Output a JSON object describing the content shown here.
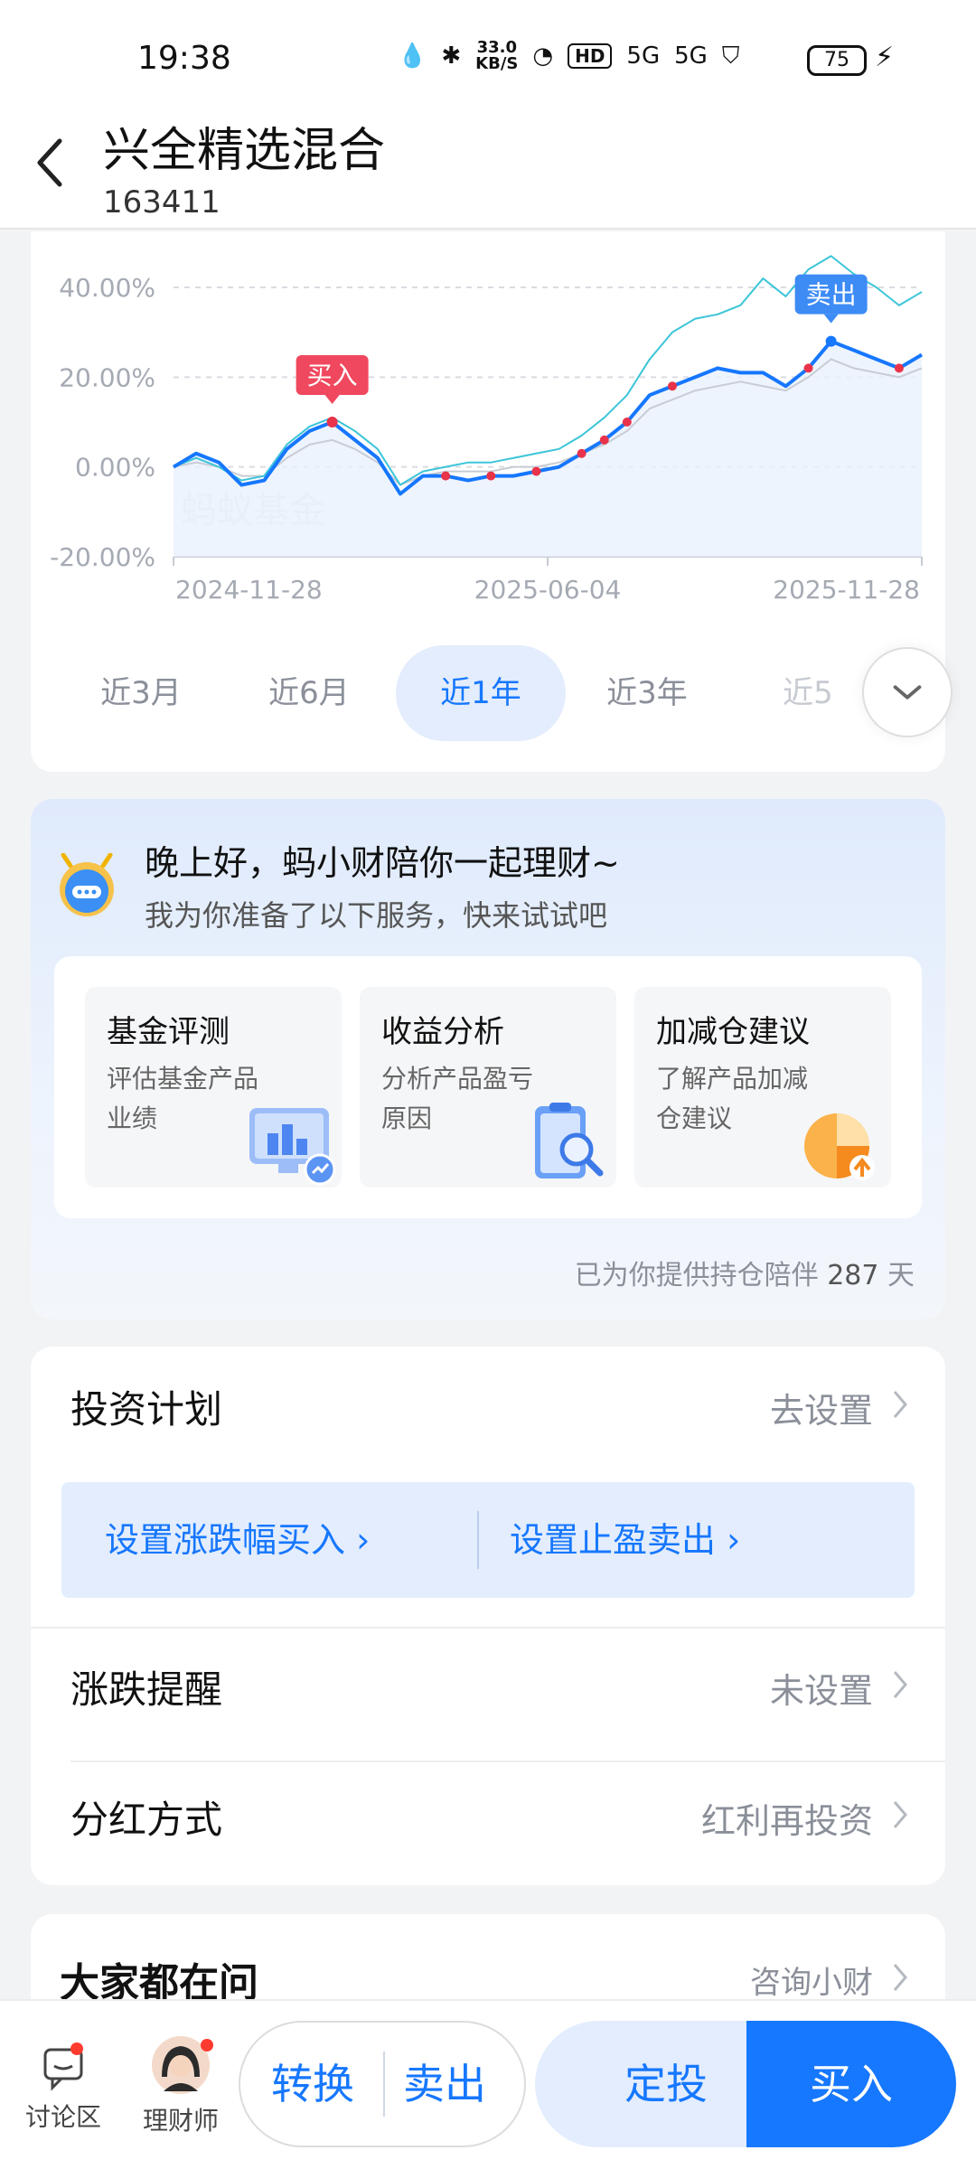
{
  "status_bar": {
    "time": "19:38",
    "net_speed_value": "33.0",
    "net_speed_unit": "KB/S",
    "hd_badge": "HD",
    "net1": "5G",
    "net2": "5G",
    "battery": "75"
  },
  "header": {
    "title": "兴全精选混合",
    "code": "163411"
  },
  "chart": {
    "watermark": "蚂蚁基金",
    "buy_tag": "买入",
    "sell_tag": "卖出",
    "colors": {
      "fund": "#1677ff",
      "index": "#3cc5d8",
      "bench": "#c8ccd4",
      "marker": "#e8334a"
    }
  },
  "chart_data": {
    "type": "line",
    "x_ticks": [
      "2024-11-28",
      "2025-06-04",
      "2025-11-28"
    ],
    "y_ticks": [
      "40.00%",
      "20.00%",
      "0.00%",
      "-20.00%"
    ],
    "ylim": [
      -20,
      45
    ],
    "grid": true,
    "series": [
      {
        "values": [
          0,
          3,
          1,
          -4,
          -3,
          4,
          8,
          10,
          6,
          2,
          -6,
          -2,
          -2,
          -3,
          -2,
          -2,
          -1,
          0,
          3,
          6,
          10,
          16,
          18,
          20,
          22,
          21,
          21,
          18,
          22,
          28,
          26,
          24,
          22,
          25
        ]
      },
      {
        "values": [
          0,
          2,
          0,
          -3,
          -2,
          5,
          9,
          11,
          8,
          4,
          -4,
          -1,
          0,
          1,
          1,
          2,
          3,
          4,
          7,
          11,
          16,
          24,
          30,
          33,
          34,
          36,
          42,
          38,
          44,
          47,
          43,
          40,
          36,
          39
        ]
      },
      {
        "values": [
          0,
          1,
          0,
          -2,
          -2,
          2,
          5,
          6,
          4,
          1,
          -4,
          -2,
          -1,
          -1,
          -1,
          0,
          0,
          1,
          3,
          5,
          8,
          13,
          15,
          17,
          18,
          19,
          18,
          17,
          20,
          24,
          22,
          21,
          20,
          22
        ]
      }
    ]
  },
  "ranges": [
    {
      "label": "近3月",
      "active": false
    },
    {
      "label": "近6月",
      "active": false
    },
    {
      "label": "近1年",
      "active": true
    },
    {
      "label": "近3年",
      "active": false
    },
    {
      "label": "近5",
      "active": false
    }
  ],
  "assistant": {
    "greeting": "晚上好，蚂小财陪你一起理财~",
    "subtitle": "我为你准备了以下服务，快来试试吧",
    "services": [
      {
        "title": "基金评测",
        "desc": "评估基金产品业绩",
        "icon": "monitor-chart-icon"
      },
      {
        "title": "收益分析",
        "desc": "分析产品盈亏原因",
        "icon": "clipboard-search-icon"
      },
      {
        "title": "加减仓建议",
        "desc": "了解产品加减仓建议",
        "icon": "pie-upload-icon"
      }
    ],
    "accompany_prefix": "已为你提供持仓陪伴",
    "accompany_days": "287",
    "accompany_suffix": "天"
  },
  "plan": {
    "invest_plan_label": "投资计划",
    "invest_plan_value": "去设置",
    "set_buy": "设置涨跌幅买入 ›",
    "set_sell": "设置止盈卖出 ›",
    "alert_label": "涨跌提醒",
    "alert_value": "未设置",
    "dividend_label": "分红方式",
    "dividend_value": "红利再投资"
  },
  "faq": {
    "title": "大家都在问",
    "link": "咨询小财"
  },
  "bottom": {
    "discuss": "讨论区",
    "advisor": "理财师",
    "convert": "转换",
    "sell": "卖出",
    "fixed": "定投",
    "buy": "买入"
  }
}
